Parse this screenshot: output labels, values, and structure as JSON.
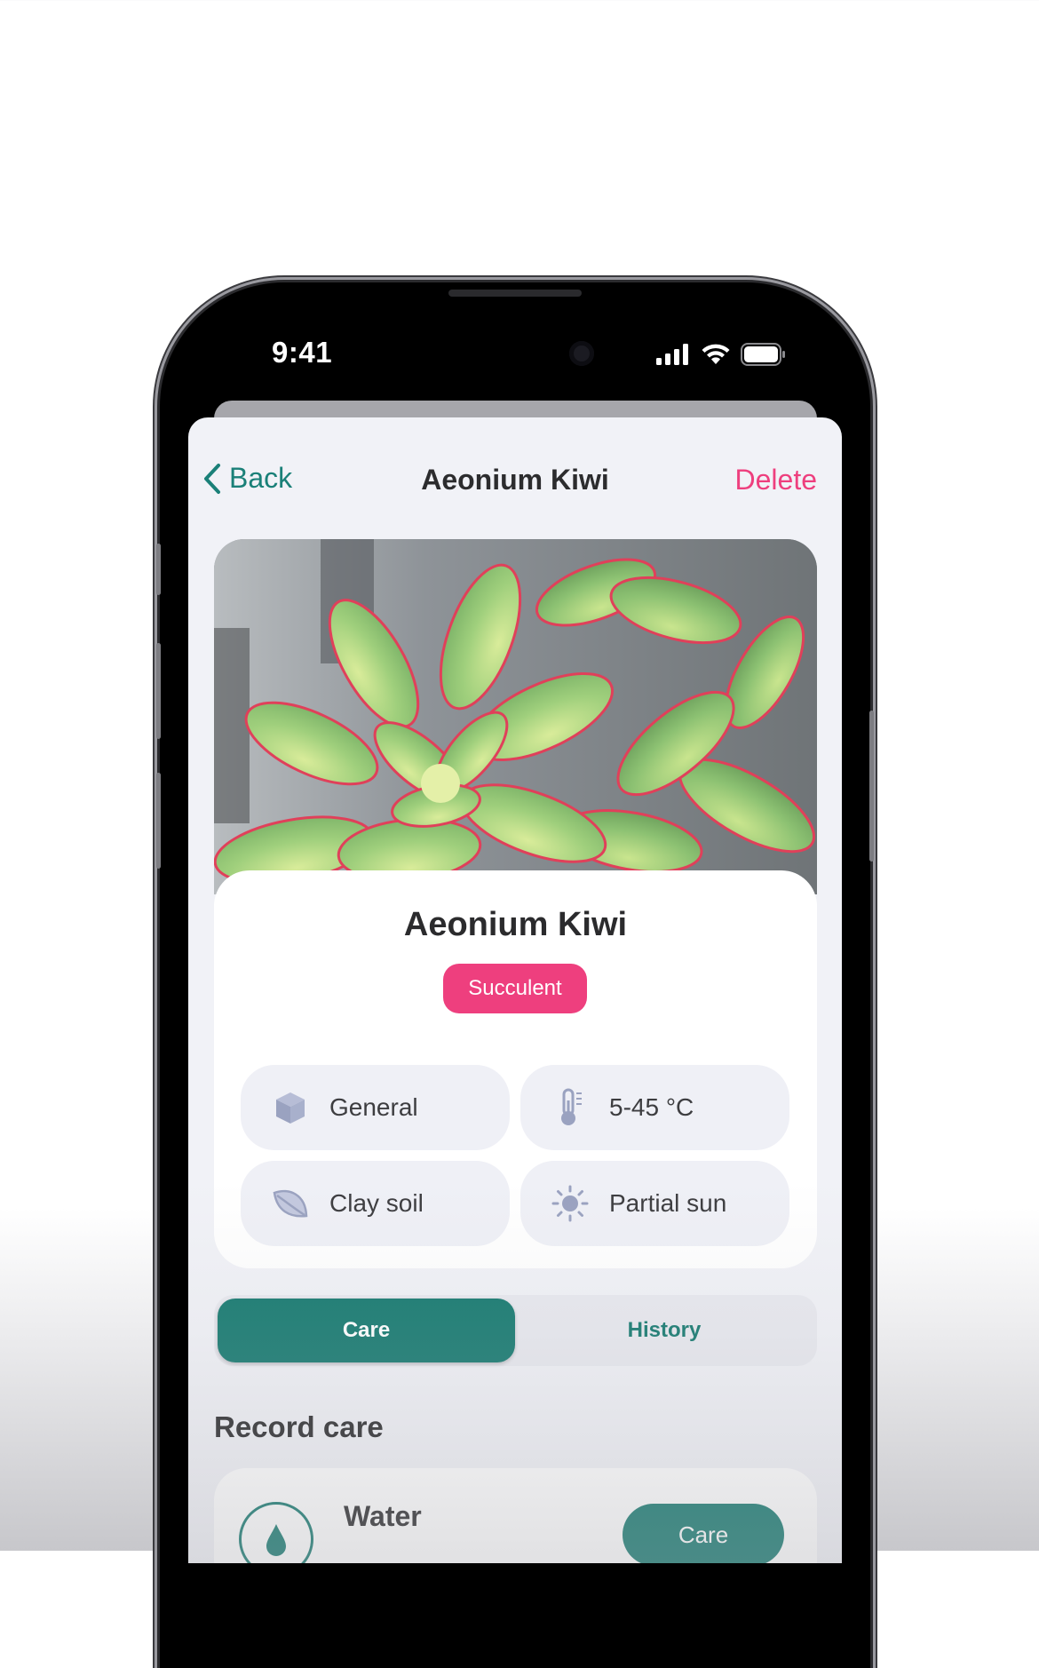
{
  "status_bar": {
    "time": "9:41"
  },
  "nav": {
    "back_label": "Back",
    "title": "Aeonium Kiwi",
    "delete_label": "Delete"
  },
  "plant": {
    "name": "Aeonium Kiwi",
    "category": "Succulent",
    "attributes": [
      {
        "icon": "cube-icon",
        "label": "General"
      },
      {
        "icon": "thermometer-icon",
        "label": "5-45 °C"
      },
      {
        "icon": "leaf-icon",
        "label": "Clay soil"
      },
      {
        "icon": "sun-icon",
        "label": "Partial sun"
      }
    ]
  },
  "segments": {
    "care": "Care",
    "history": "History",
    "selected": "Care"
  },
  "record_care": {
    "title": "Record care",
    "items": [
      {
        "icon": "water-drop-icon",
        "label": "Water",
        "button": "Care"
      }
    ]
  },
  "colors": {
    "accent": "#167a70",
    "danger": "#ee3f7e",
    "tag": "#ee3f7e",
    "screen_bg": "#f1f2f7"
  }
}
